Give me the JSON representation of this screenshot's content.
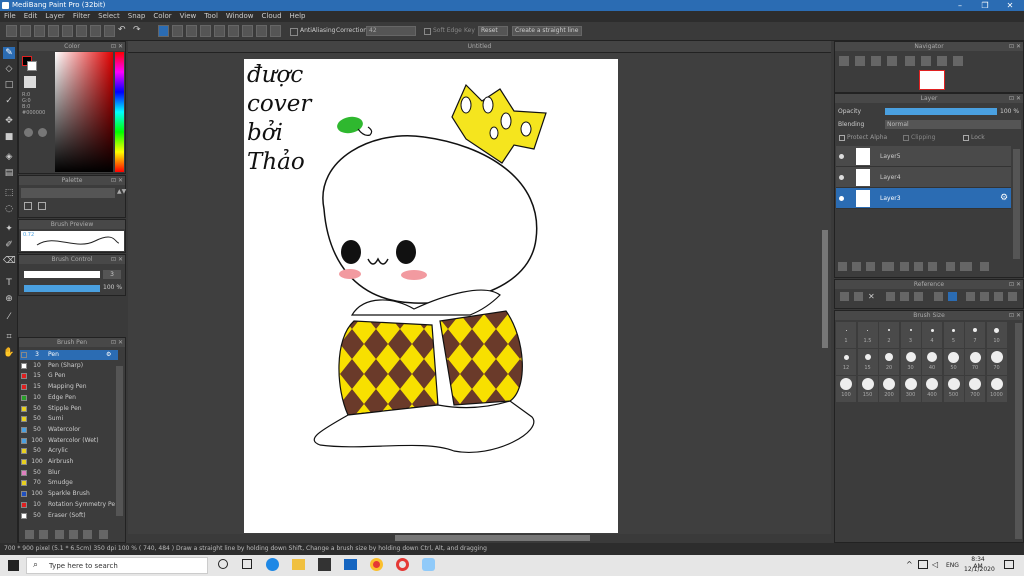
{
  "window": {
    "title": "MediBang Paint Pro (32bit)"
  },
  "menu": [
    "File",
    "Edit",
    "Layer",
    "Filter",
    "Select",
    "Snap",
    "Color",
    "View",
    "Tool",
    "Window",
    "Cloud",
    "Help"
  ],
  "toolbar": {
    "antialias_label": "AntiAliasing",
    "correction_label": "Correction",
    "correction_value": "42",
    "soft_edge_label": "Soft Edge",
    "key_label": "Key",
    "reset_label": "Reset",
    "straight_line_label": "Create a straight line"
  },
  "canvas": {
    "tab_title": "Untitled"
  },
  "panels": {
    "color": "Color",
    "palette": "Palette",
    "brush_preview": "Brush Preview",
    "brush_control": "Brush Control",
    "brush_pen": "Brush Pen",
    "navigator": "Navigator",
    "layer": "Layer",
    "reference": "Reference",
    "brush_size": "Brush Size"
  },
  "color_panel": {
    "r": "R:0",
    "g": "G:0",
    "b": "B:0",
    "hex": "#000000"
  },
  "brush_preview_value": "0.72",
  "brush_control": {
    "size_value": "3",
    "opacity_value": "100 %",
    "opacity_fraction": 1.0
  },
  "brushes": [
    {
      "size": "3",
      "name": "Pen",
      "color": "#2b6cb3",
      "selected": true
    },
    {
      "size": "10",
      "name": "Pen (Sharp)",
      "color": "#ffffff"
    },
    {
      "size": "15",
      "name": "G Pen",
      "color": "#e02020"
    },
    {
      "size": "15",
      "name": "Mapping Pen",
      "color": "#e02020"
    },
    {
      "size": "10",
      "name": "Edge Pen",
      "color": "#2aa02a"
    },
    {
      "size": "50",
      "name": "Stipple Pen",
      "color": "#e8d020"
    },
    {
      "size": "50",
      "name": "Sumi",
      "color": "#e8d020"
    },
    {
      "size": "50",
      "name": "Watercolor",
      "color": "#4aa0e0"
    },
    {
      "size": "100",
      "name": "Watercolor (Wet)",
      "color": "#4aa0e0"
    },
    {
      "size": "50",
      "name": "Acrylic",
      "color": "#e8d020"
    },
    {
      "size": "100",
      "name": "Airbrush",
      "color": "#e8d020"
    },
    {
      "size": "50",
      "name": "Blur",
      "color": "#e080c0"
    },
    {
      "size": "70",
      "name": "Smudge",
      "color": "#e8d020"
    },
    {
      "size": "100",
      "name": "Sparkle Brush",
      "color": "#2050c0"
    },
    {
      "size": "10",
      "name": "Rotation Symmetry Pe",
      "color": "#e02020"
    },
    {
      "size": "50",
      "name": "Eraser (Soft)",
      "color": "#ffffff"
    }
  ],
  "layer_panel": {
    "opacity_label": "Opacity",
    "opacity_value": "100 %",
    "opacity_fraction": 1.0,
    "blending_label": "Blending",
    "blending_value": "Normal",
    "protect_alpha": "Protect Alpha",
    "clipping": "Clipping",
    "lock": "Lock",
    "layers": [
      {
        "name": "Layer5",
        "selected": false
      },
      {
        "name": "Layer4",
        "selected": false
      },
      {
        "name": "Layer3",
        "selected": true
      }
    ]
  },
  "brush_sizes": {
    "row1": [
      "1",
      "1.5",
      "2",
      "3",
      "4",
      "5",
      "7",
      "10"
    ],
    "row2": [
      "12",
      "15",
      "20",
      "30",
      "40",
      "50",
      "70",
      "70"
    ],
    "row3": [
      "100",
      "150",
      "200",
      "300",
      "400",
      "500",
      "700",
      "1000"
    ]
  },
  "drawing_text": [
    "được",
    "cover",
    "bởi",
    "Thảo"
  ],
  "statusbar": {
    "text": "700 * 900 pixel  (5.1 * 6.5cm)  350 dpi  100 %  ( 740, 484 )  Draw a straight line by holding down Shift, Change a brush size by holding down Ctrl, Alt, and dragging"
  },
  "taskbar": {
    "search_placeholder": "Type here to search",
    "time": "8:34 AM",
    "date": "12/1/2020",
    "lang": "ENG"
  },
  "colors": {
    "accent": "#2b6cb3",
    "crown": "#f5e51e",
    "diamond_dark": "#6a3a2a",
    "diamond_light": "#f8e000",
    "leaf": "#2fb82f",
    "blush": "#f29aa0"
  }
}
